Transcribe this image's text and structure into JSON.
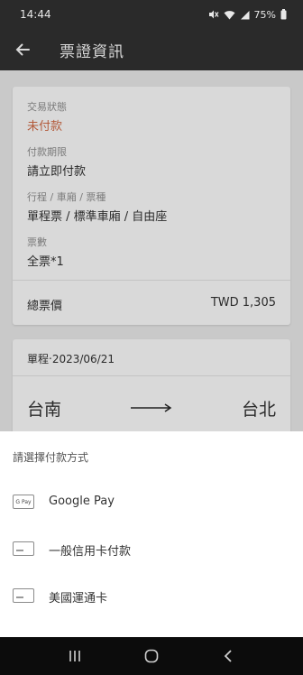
{
  "status": {
    "time": "14:44",
    "battery": "75%"
  },
  "app_bar": {
    "title": "票證資訊",
    "back_icon": "arrow-left-icon"
  },
  "ticket": {
    "status_label": "交易狀態",
    "status_value": "未付款",
    "deadline_label": "付款期限",
    "deadline_value": "請立即付款",
    "trip_label": "行程 / 車廂 / 票種",
    "trip_value": "單程票 / 標準車廂 / 自由座",
    "count_label": "票數",
    "count_value": "全票*1",
    "total_label": "總票價",
    "total_value": "TWD 1,305"
  },
  "journey": {
    "date": "單程‧2023/06/21",
    "from": "台南",
    "to": "台北"
  },
  "payment_sheet": {
    "title": "請選擇付款方式",
    "options": [
      {
        "label": "Google Pay",
        "icon": "google-pay-icon",
        "icon_text": "G Pay"
      },
      {
        "label": "一般信用卡付款",
        "icon": "credit-card-icon"
      },
      {
        "label": "美國運通卡",
        "icon": "credit-card-icon"
      }
    ]
  },
  "colors": {
    "unpaid": "#b35a3a",
    "app_bar": "#2a2a2a",
    "overlay": "#c9c9c9"
  }
}
